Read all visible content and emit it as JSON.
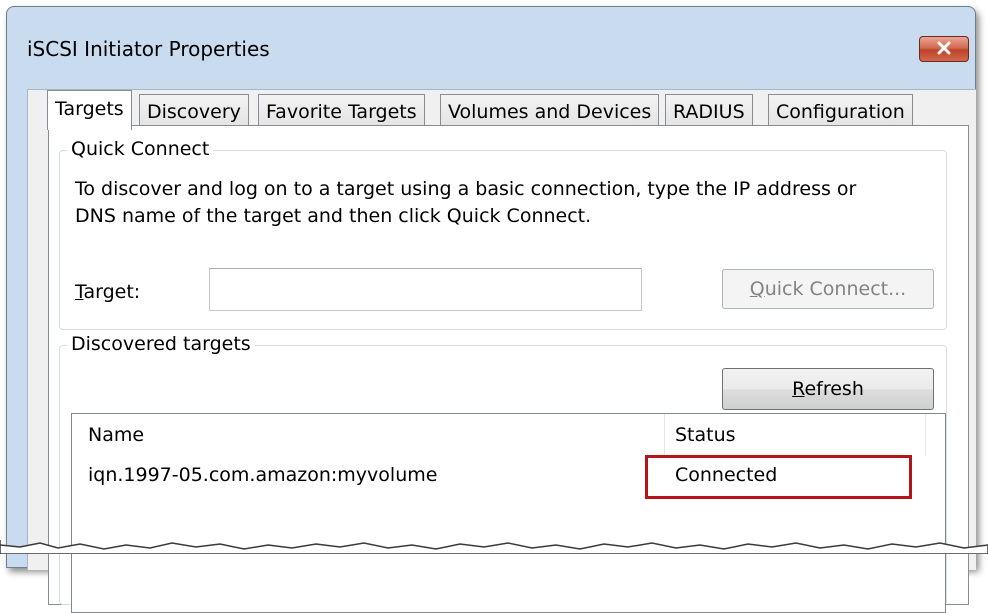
{
  "window": {
    "title": "iSCSI Initiator Properties"
  },
  "tabs": [
    {
      "label": "Targets",
      "active": true
    },
    {
      "label": "Discovery",
      "active": false
    },
    {
      "label": "Favorite Targets",
      "active": false
    },
    {
      "label": "Volumes and Devices",
      "active": false
    },
    {
      "label": "RADIUS",
      "active": false
    },
    {
      "label": "Configuration",
      "active": false
    }
  ],
  "quick_connect": {
    "group_label": "Quick Connect",
    "description_line1": "To discover and log on to a target using a basic connection, type the IP address or",
    "description_line2": "DNS name of the target and then click Quick Connect.",
    "target_label_accel": "T",
    "target_label_rest": "arget:",
    "target_value": "",
    "button_accel": "Q",
    "button_rest": "uick Connect..."
  },
  "discovered": {
    "group_label_pre": "Discovered tar",
    "group_label_accel": "g",
    "group_label_post": "ets",
    "refresh_accel": "R",
    "refresh_rest": "efresh",
    "columns": {
      "name": "Name",
      "status": "Status"
    },
    "rows": [
      {
        "name": "iqn.1997-05.com.amazon:myvolume",
        "status": "Connected"
      }
    ]
  },
  "colors": {
    "title_bar": "#c9dbef",
    "highlight": "#b4151a",
    "close_button": "#c0432a"
  },
  "icons": {
    "close": "close-icon"
  }
}
